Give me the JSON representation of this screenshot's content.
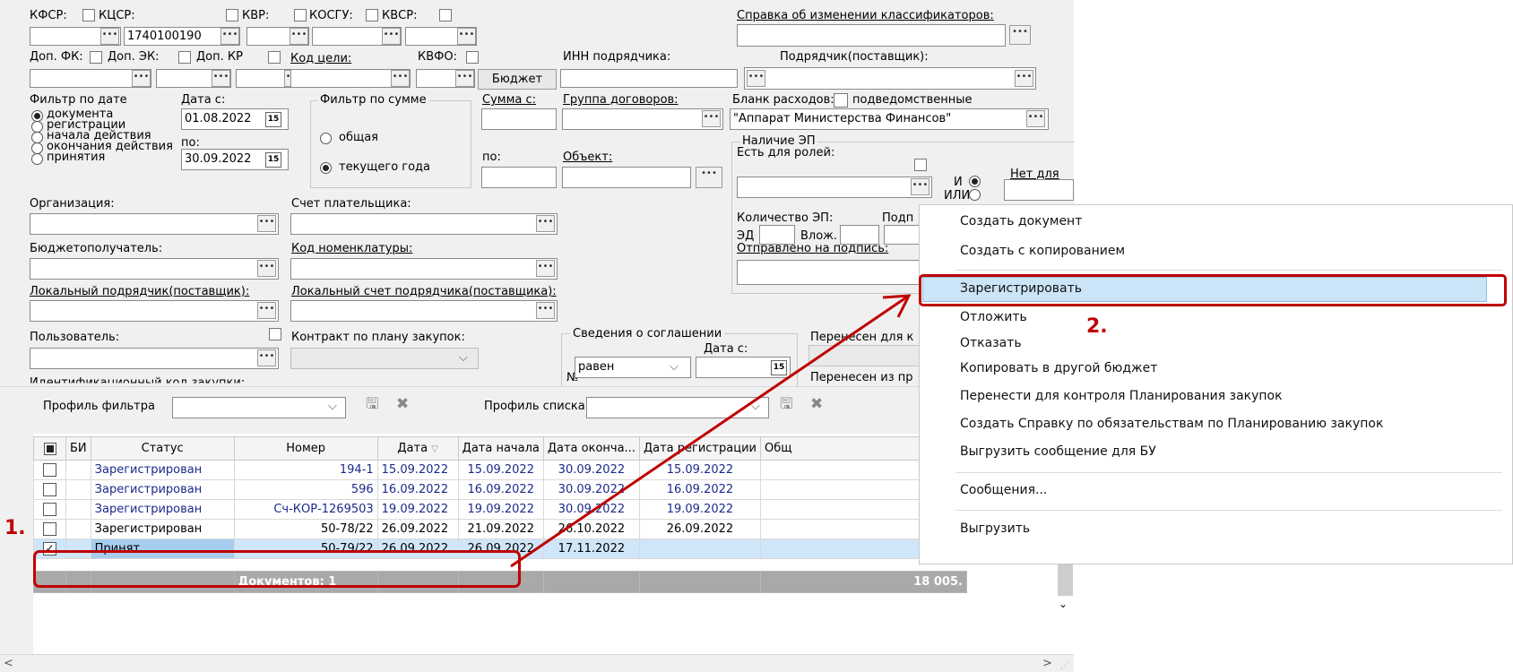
{
  "filters": {
    "kfsr": "КФСР:",
    "kcsr": "КЦСР:",
    "kvr": "КВР:",
    "kosgu": "КОСГУ:",
    "kvsr": "КВСР:",
    "kcsr_value": "1740100190",
    "spravka": "Справка об изменении классификаторов:",
    "dop_fk": "Доп. ФК:",
    "dop_ek": "Доп. ЭК:",
    "dop_kr": "Доп. КР",
    "kod_celi": "Код цели:",
    "kvfo": "КВФО:",
    "budget_btn": "Бюджет",
    "inn": "ИНН подрядчика:",
    "podryadchik": "Подрядчик(поставщик):",
    "date_filter": "Фильтр по дате",
    "date_opts": [
      "документа",
      "регистрации",
      "начала действия",
      "окончания действия",
      "принятия"
    ],
    "date_from_label": "Дата с:",
    "date_from": "01.08.2022",
    "date_to_label": "по:",
    "date_to": "30.09.2022",
    "sum_filter": "Фильтр по сумме",
    "sum_total": "общая",
    "sum_year": "текущего года",
    "sum_from": "Сумма с:",
    "sum_to": "по:",
    "group": "Группа договоров:",
    "object": "Объект:",
    "blank": "Бланк расходов:",
    "podved": "подведомственные",
    "blank_value": "\"Аппарат Министерства Финансов\"",
    "ep_group": "Наличие ЭП",
    "ep_roles": "Есть для ролей:",
    "and": "И",
    "or": "ИЛИ",
    "no_for": "Нет для",
    "org": "Организация:",
    "schet_plat": "Счет плательщика:",
    "budget_rec": "Бюджетополучатель:",
    "kod_nomen": "Код номенклатуры:",
    "ep_count": "Количество ЭП:",
    "podp": "Подп",
    "ed": "ЭД",
    "vlozh": "Влож.",
    "sent_sign": "Отправлено на подпись:",
    "local_podr": "Локальный подрядчик(поставщик):",
    "local_schet": "Локальный счет подрядчика(поставщика):",
    "user": "Пользователь:",
    "contract_plan": "Контракт по плану закупок:",
    "agreement": "Сведения о соглашении",
    "agree_date": "Дата с:",
    "agree_no": "№",
    "agree_eq": "равен",
    "moved_to": "Перенесен для к",
    "moved_from": "Перенесен из пр",
    "ident_code": "Идентификационный код закупки:"
  },
  "profile": {
    "filter": "Профиль фильтра",
    "list": "Профиль списка"
  },
  "table": {
    "headers": [
      "БИ",
      "Статус",
      "Номер",
      "Дата",
      "Дата начала",
      "Дата оконча...",
      "Дата регистрации",
      "Общ"
    ],
    "rows": [
      {
        "status": "Зарегистрирован",
        "num": "194-1",
        "date": "15.09.2022",
        "start": "15.09.2022",
        "end": "30.09.2022",
        "reg": "15.09.2022",
        "sum": ""
      },
      {
        "status": "Зарегистрирован",
        "num": "596",
        "date": "16.09.2022",
        "start": "16.09.2022",
        "end": "30.09.2022",
        "reg": "16.09.2022",
        "sum": ""
      },
      {
        "status": "Зарегистрирован",
        "num": "Сч-КОР-1269503",
        "date": "19.09.2022",
        "start": "19.09.2022",
        "end": "30.09.2022",
        "reg": "19.09.2022",
        "sum": ""
      },
      {
        "status": "Зарегистрирован",
        "num": "50-78/22",
        "date": "26.09.2022",
        "start": "21.09.2022",
        "end": "26.10.2022",
        "reg": "26.09.2022",
        "sum": ""
      },
      {
        "status": "Принят",
        "num": "50-79/22",
        "date": "26.09.2022",
        "start": "26.09.2022",
        "end": "17.11.2022",
        "reg": "",
        "sum": "18 005."
      }
    ],
    "footer_count": "Документов: 1",
    "footer_sum": "18 005."
  },
  "context_menu": {
    "items": [
      "Создать документ",
      "Создать с копированием",
      "Зарегистрировать",
      "Отложить",
      "Отказать",
      "Копировать в другой бюджет",
      "Перенести для контроля Планирования закупок",
      "Создать Справку по обязательствам по Планированию закупок",
      "Выгрузить сообщение для БУ",
      "Сообщения...",
      "Выгрузить"
    ]
  },
  "annotations": {
    "step1": "1.",
    "step2": "2.",
    "color": "#c00000"
  }
}
